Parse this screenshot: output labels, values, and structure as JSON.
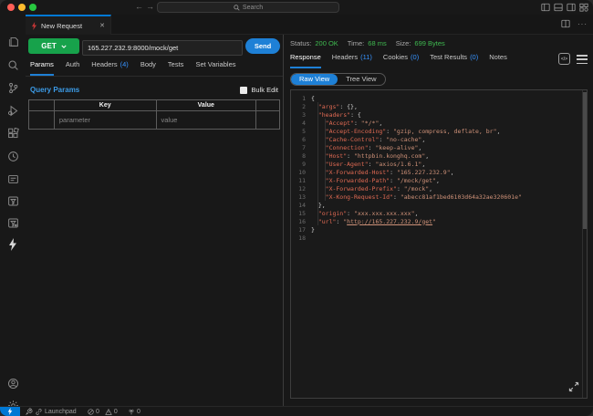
{
  "titlebar": {
    "search_placeholder": "Search"
  },
  "editor_tab": {
    "title": "New Request",
    "close_glyph": "✕"
  },
  "request_panel": {
    "method": "GET",
    "url": "165.227.232.9:8000/mock/get",
    "send_label": "Send",
    "tabs": [
      {
        "label": "Params",
        "active": true
      },
      {
        "label": "Auth"
      },
      {
        "label": "Headers",
        "count": "(4)"
      },
      {
        "label": "Body"
      },
      {
        "label": "Tests"
      },
      {
        "label": "Set Variables"
      }
    ],
    "section_title": "Query Params",
    "bulk_edit_label": "Bulk Edit",
    "table": {
      "columns": [
        "Key",
        "Value"
      ],
      "placeholder": {
        "key": "parameter",
        "value": "value"
      }
    }
  },
  "response_panel": {
    "status_label": "Status:",
    "status_value": "200 OK",
    "time_label": "Time:",
    "time_value": "68 ms",
    "size_label": "Size:",
    "size_value": "699 Bytes",
    "tabs": [
      {
        "label": "Response",
        "active": true
      },
      {
        "label": "Headers",
        "count": "(11)"
      },
      {
        "label": "Cookies",
        "count": "(0)"
      },
      {
        "label": "Test Results",
        "count": "(0)"
      },
      {
        "label": "Notes"
      }
    ],
    "raw_view_label": "Raw View",
    "tree_view_label": "Tree View",
    "code_lines": [
      {
        "n": "1",
        "seg": [
          [
            "p",
            "{"
          ]
        ]
      },
      {
        "n": "2",
        "seg": [
          [
            "p",
            "  "
          ],
          [
            "k",
            "\"args\""
          ],
          [
            "p",
            ": {},"
          ]
        ]
      },
      {
        "n": "3",
        "seg": [
          [
            "p",
            "  "
          ],
          [
            "k",
            "\"headers\""
          ],
          [
            "p",
            ": {"
          ]
        ]
      },
      {
        "n": "4",
        "seg": [
          [
            "p",
            "    "
          ],
          [
            "k",
            "\"Accept\""
          ],
          [
            "p",
            ": "
          ],
          [
            "v",
            "\"*/*\""
          ],
          [
            "p",
            ","
          ]
        ]
      },
      {
        "n": "5",
        "seg": [
          [
            "p",
            "    "
          ],
          [
            "k",
            "\"Accept-Encoding\""
          ],
          [
            "p",
            ": "
          ],
          [
            "v",
            "\"gzip, compress, deflate, br\""
          ],
          [
            "p",
            ","
          ]
        ]
      },
      {
        "n": "6",
        "seg": [
          [
            "p",
            "    "
          ],
          [
            "k",
            "\"Cache-Control\""
          ],
          [
            "p",
            ": "
          ],
          [
            "v",
            "\"no-cache\""
          ],
          [
            "p",
            ","
          ]
        ]
      },
      {
        "n": "7",
        "seg": [
          [
            "p",
            "    "
          ],
          [
            "k",
            "\"Connection\""
          ],
          [
            "p",
            ": "
          ],
          [
            "v",
            "\"keep-alive\""
          ],
          [
            "p",
            ","
          ]
        ]
      },
      {
        "n": "8",
        "seg": [
          [
            "p",
            "    "
          ],
          [
            "k",
            "\"Host\""
          ],
          [
            "p",
            ": "
          ],
          [
            "v",
            "\"httpbin.konghq.com\""
          ],
          [
            "p",
            ","
          ]
        ]
      },
      {
        "n": "9",
        "seg": [
          [
            "p",
            "    "
          ],
          [
            "k",
            "\"User-Agent\""
          ],
          [
            "p",
            ": "
          ],
          [
            "v",
            "\"axios/1.6.1\""
          ],
          [
            "p",
            ","
          ]
        ]
      },
      {
        "n": "10",
        "seg": [
          [
            "p",
            "    "
          ],
          [
            "k",
            "\"X-Forwarded-Host\""
          ],
          [
            "p",
            ": "
          ],
          [
            "v",
            "\"165.227.232.9\""
          ],
          [
            "p",
            ","
          ]
        ]
      },
      {
        "n": "11",
        "seg": [
          [
            "p",
            "    "
          ],
          [
            "k",
            "\"X-Forwarded-Path\""
          ],
          [
            "p",
            ": "
          ],
          [
            "v",
            "\"/mock/get\""
          ],
          [
            "p",
            ","
          ]
        ]
      },
      {
        "n": "12",
        "seg": [
          [
            "p",
            "    "
          ],
          [
            "k",
            "\"X-Forwarded-Prefix\""
          ],
          [
            "p",
            ": "
          ],
          [
            "v",
            "\"/mock\""
          ],
          [
            "p",
            ","
          ]
        ]
      },
      {
        "n": "13",
        "seg": [
          [
            "p",
            "    "
          ],
          [
            "k",
            "\"X-Kong-Request-Id\""
          ],
          [
            "p",
            ": "
          ],
          [
            "v",
            "\"abecc81af1bed6103d64a32ae320601e\""
          ]
        ]
      },
      {
        "n": "14",
        "seg": [
          [
            "p",
            "  },"
          ]
        ]
      },
      {
        "n": "15",
        "seg": [
          [
            "p",
            "  "
          ],
          [
            "k",
            "\"origin\""
          ],
          [
            "p",
            ": "
          ],
          [
            "v",
            "\"xxx.xxx.xxx.xxx\""
          ],
          [
            "p",
            ","
          ]
        ]
      },
      {
        "n": "16",
        "seg": [
          [
            "p",
            "  "
          ],
          [
            "k",
            "\"url\""
          ],
          [
            "p",
            ": "
          ],
          [
            "v",
            "\""
          ],
          [
            "u",
            "http://165.227.232.9/get"
          ],
          [
            "v",
            "\""
          ]
        ]
      },
      {
        "n": "17",
        "seg": [
          [
            "p",
            "}"
          ]
        ]
      },
      {
        "n": "18",
        "seg": []
      }
    ]
  },
  "status_bar": {
    "launchpad_label": "Launchpad",
    "error_count": "0",
    "warning_count": "0",
    "port_count": "0"
  },
  "colors": {
    "accent_blue": "#1e80d6",
    "count_blue": "#3794ff",
    "method_green": "#17a24b",
    "status_green": "#3fb950",
    "json_key": "#e06a53",
    "json_string": "#ce9178",
    "tab_accent": "#0078d4"
  }
}
